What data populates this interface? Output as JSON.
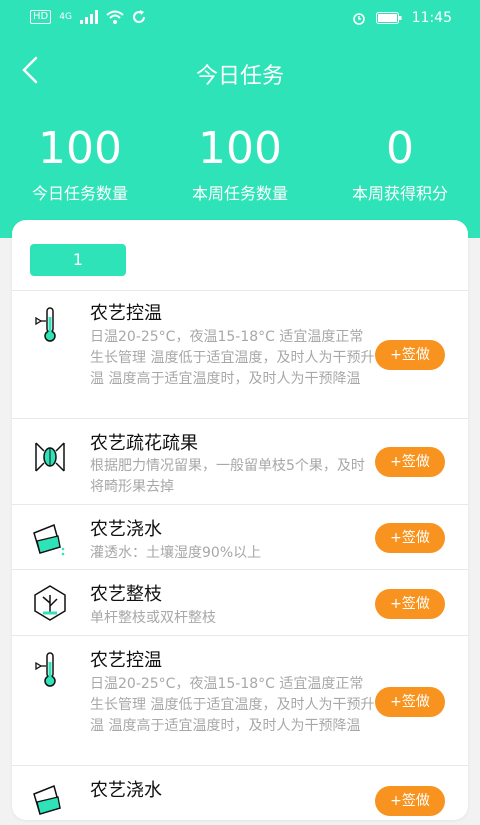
{
  "status_bar": {
    "left_text": "HD",
    "network": "4G",
    "time": "11:45"
  },
  "header": {
    "title": "今日任务"
  },
  "stats": [
    {
      "value": "100",
      "label": "今日任务数量"
    },
    {
      "value": "100",
      "label": "本周任务数量"
    },
    {
      "value": "0",
      "label": "本周获得积分"
    }
  ],
  "group_tag": "1",
  "tasks": [
    {
      "icon": "thermometer-icon",
      "title": "农艺控温",
      "desc": "日温20-25°C，夜温15-18°C 适宜温度正常生长管理 温度低于适宜温度，及时人为干预升温 温度高于适宜温度时，及时人为干预降温",
      "button": "+签做"
    },
    {
      "icon": "flower-thinning-icon",
      "title": "农艺疏花疏果",
      "desc": "根据肥力情况留果，一般留单枝5个果，及时将畸形果去掉",
      "button": "+签做"
    },
    {
      "icon": "watering-icon",
      "title": "农艺浇水",
      "desc": "灌透水：土壤湿度90%以上",
      "button": "+签做"
    },
    {
      "icon": "pruning-icon",
      "title": "农艺整枝",
      "desc": "单杆整枝或双杆整枝",
      "button": "+签做"
    },
    {
      "icon": "thermometer-icon",
      "title": "农艺控温",
      "desc": "日温20-25°C，夜温15-18°C 适宜温度正常生长管理 温度低于适宜温度，及时人为干预升温 温度高于适宜温度时，及时人为干预降温",
      "button": "+签做"
    },
    {
      "icon": "watering-icon",
      "title": "农艺浇水",
      "desc": "",
      "button": "+签做"
    }
  ],
  "colors": {
    "primary": "#2fe3b8",
    "accent": "#f7931e"
  }
}
